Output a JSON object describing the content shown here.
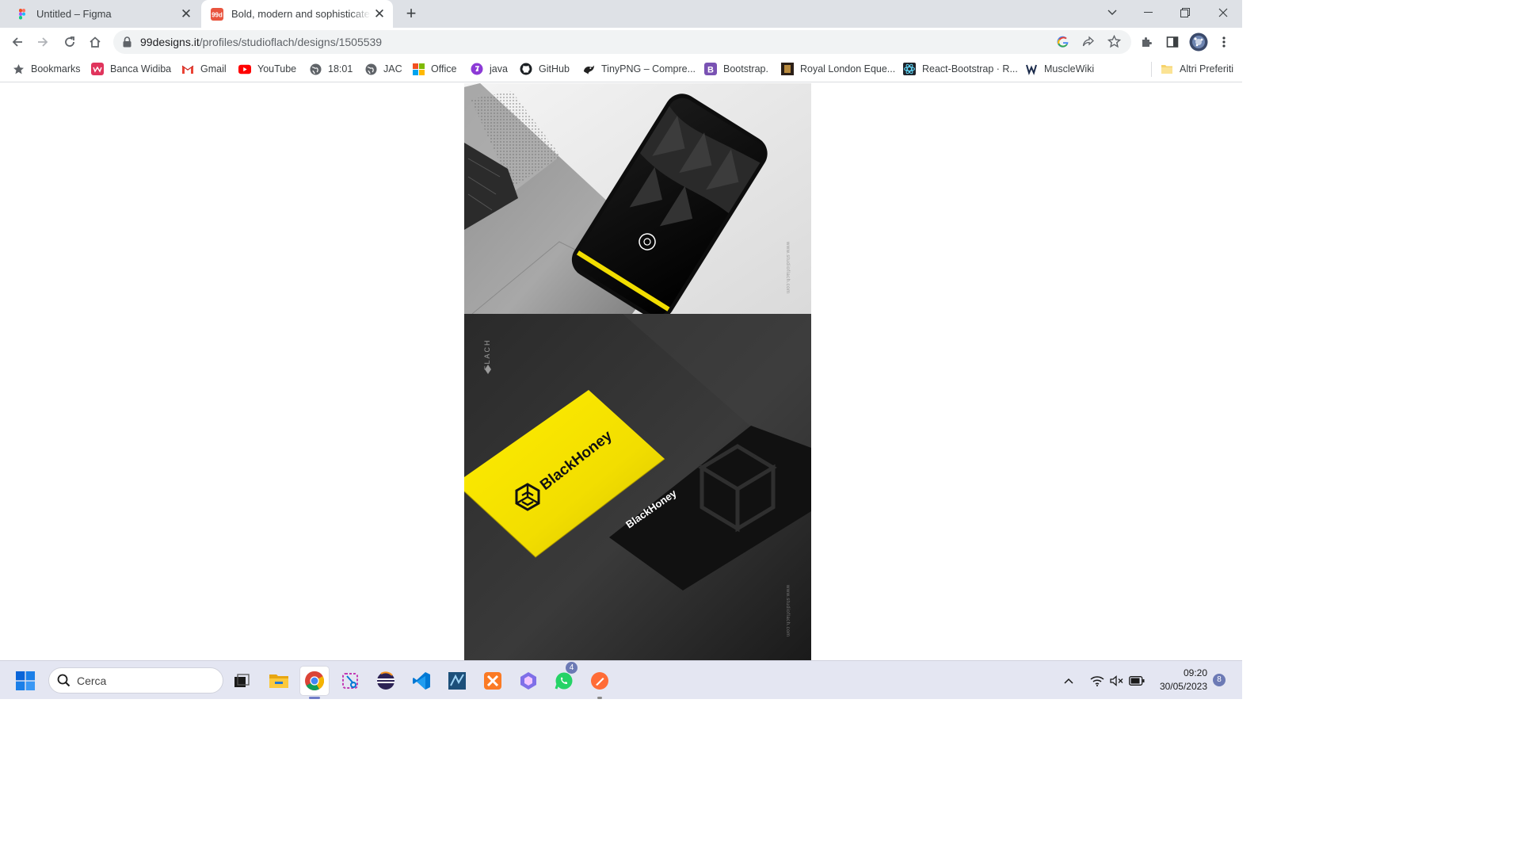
{
  "tabs": [
    {
      "title": "Untitled – Figma",
      "icon": "figma-icon",
      "active": false
    },
    {
      "title": "Bold, modern and sophisticated logo for BlackHoney",
      "icon": "99designs-icon",
      "active": true
    }
  ],
  "address_bar": {
    "url_host": "99designs.it",
    "url_path": "/profiles/studioflach/designs/1505539"
  },
  "bookmarks": {
    "items": [
      {
        "label": "Bookmarks",
        "icon": "star-icon"
      },
      {
        "label": "Banca Widiba",
        "icon": "widiba-icon"
      },
      {
        "label": "Gmail",
        "icon": "gmail-icon"
      },
      {
        "label": "YouTube",
        "icon": "youtube-icon"
      },
      {
        "label": "18:01",
        "icon": "globe-icon"
      },
      {
        "label": "JAC",
        "icon": "globe-icon"
      },
      {
        "label": "Office",
        "icon": "office-icon"
      },
      {
        "label": "java",
        "icon": "java-icon"
      },
      {
        "label": "GitHub",
        "icon": "github-icon"
      },
      {
        "label": "TinyPNG – Compre...",
        "icon": "tinypng-icon"
      },
      {
        "label": "Bootstrap.",
        "icon": "bootstrap-icon"
      },
      {
        "label": "Royal London Eque...",
        "icon": "royal-london-icon"
      },
      {
        "label": "React-Bootstrap · R...",
        "icon": "react-bootstrap-icon"
      },
      {
        "label": "MuscleWiki",
        "icon": "musclewiki-icon"
      }
    ],
    "other_folder": "Altri Preferiti"
  },
  "design_image": {
    "brand": "BlackHoney",
    "studio_mark": "FLACH",
    "url_print": "www.studioflach.com"
  },
  "taskbar": {
    "search_placeholder": "Cerca",
    "whatsapp_badge": "4",
    "time": "09:20",
    "date": "30/05/2023",
    "notification_count": "8",
    "apps": [
      "task-view-icon",
      "file-explorer-icon",
      "chrome-icon",
      "snipping-tool-icon",
      "eclipse-icon",
      "vscode-icon",
      "mysql-workbench-icon",
      "xampp-icon",
      "copilot-icon",
      "whatsapp-icon",
      "postman-icon"
    ]
  },
  "colors": {
    "brand_yellow": "#f2de00",
    "tab_strip": "#dee1e6",
    "taskbar": "#e4e6f2"
  }
}
